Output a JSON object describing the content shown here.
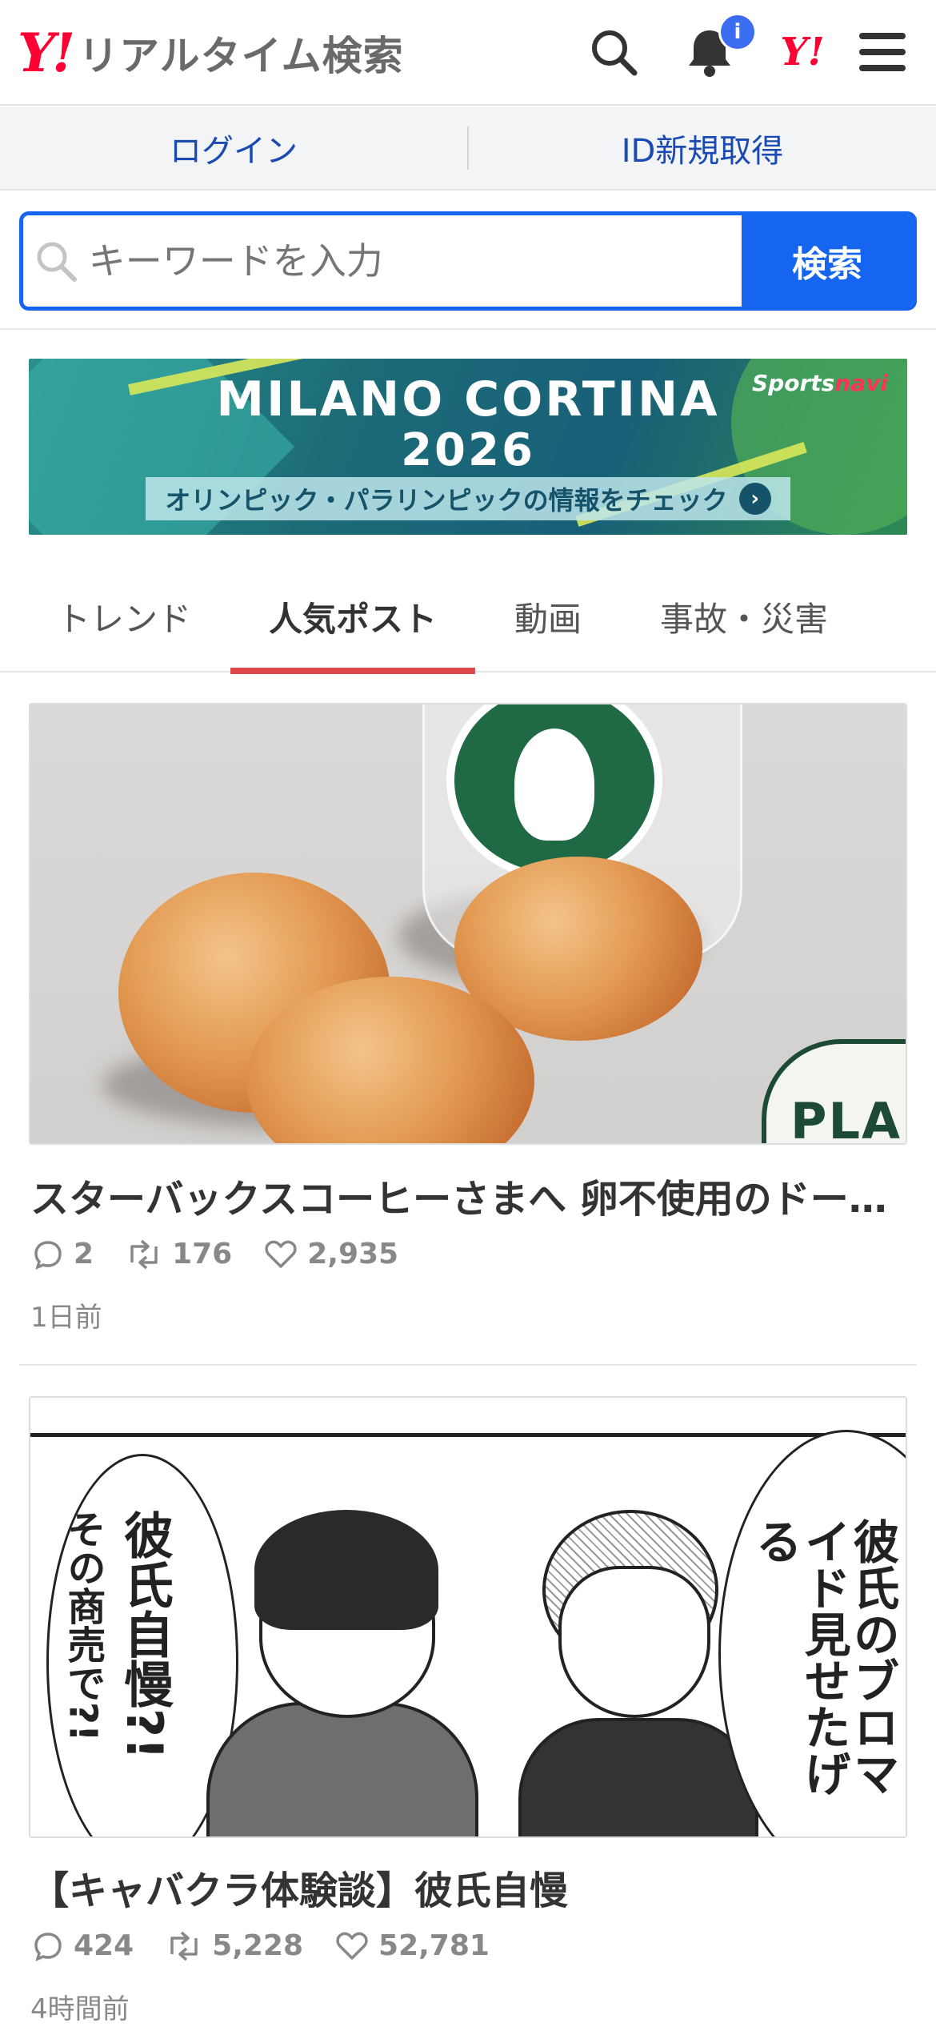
{
  "header": {
    "logo_mark": "Y!",
    "logo_text": "リアルタイム検索",
    "notification_badge": "i",
    "yj_mark": "Y!"
  },
  "auth": {
    "login": "ログイン",
    "register": "ID新規取得"
  },
  "search": {
    "placeholder": "キーワードを入力",
    "button": "検索"
  },
  "banner": {
    "title": "MILANO CORTINA",
    "year": "2026",
    "cta": "オリンピック・パラリンピックの情報をチェック",
    "brand_a": "Sports",
    "brand_b": "navi"
  },
  "tabs": [
    {
      "label": "トレンド",
      "active": false
    },
    {
      "label": "人気ポスト",
      "active": true
    },
    {
      "label": "動画",
      "active": false
    },
    {
      "label": "事故・災害",
      "active": false
    }
  ],
  "posts": [
    {
      "title": "スターバックスコーヒーさまへ 卵不使用のドーナツ",
      "replies": "2",
      "reposts": "176",
      "likes": "2,935",
      "time": "1日前",
      "image_text": "PLANT"
    },
    {
      "title": "【キャバクラ体験談】彼氏自慢",
      "replies": "424",
      "reposts": "5,228",
      "likes": "52,781",
      "time": "4時間前",
      "bubble_left_1": "彼氏自慢?!",
      "bubble_left_2": "その商売で?!",
      "bubble_right": "彼氏のブロマイド見せたげる"
    }
  ],
  "colors": {
    "brand_red": "#ff0033",
    "search_blue": "#1565f0",
    "tab_active": "#e0484a",
    "link_blue": "#1a4ab2"
  }
}
